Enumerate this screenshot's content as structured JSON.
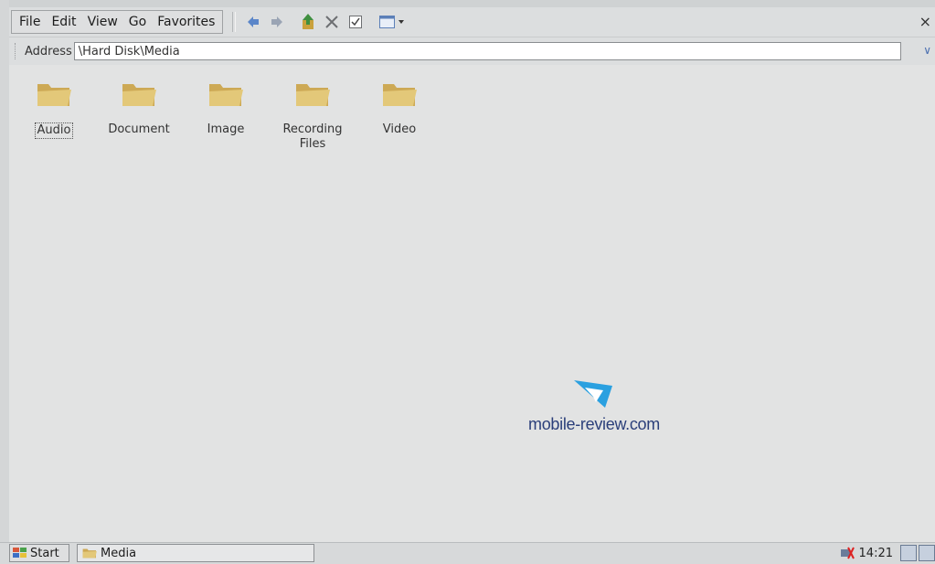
{
  "menubar": {
    "items": [
      "File",
      "Edit",
      "View",
      "Go",
      "Favorites"
    ],
    "close_label": "×"
  },
  "toolbar": {
    "icons": [
      "back-icon",
      "forward-icon",
      "up-folder-icon",
      "delete-icon",
      "properties-icon",
      "views-icon"
    ]
  },
  "address": {
    "label": "Address",
    "value": "\\Hard Disk\\Media"
  },
  "folders": [
    {
      "label": "Audio",
      "selected": true
    },
    {
      "label": "Document",
      "selected": false
    },
    {
      "label": "Image",
      "selected": false
    },
    {
      "label": "Recording Files",
      "selected": false
    },
    {
      "label": "Video",
      "selected": false
    }
  ],
  "watermark": {
    "text": "mobile-review.com"
  },
  "taskbar": {
    "start_label": "Start",
    "task_label": "Media",
    "clock": "14:21"
  },
  "colors": {
    "background": "#e2e3e3",
    "folder": "#d9bf72",
    "watermark_accent": "#2aa0e0"
  }
}
